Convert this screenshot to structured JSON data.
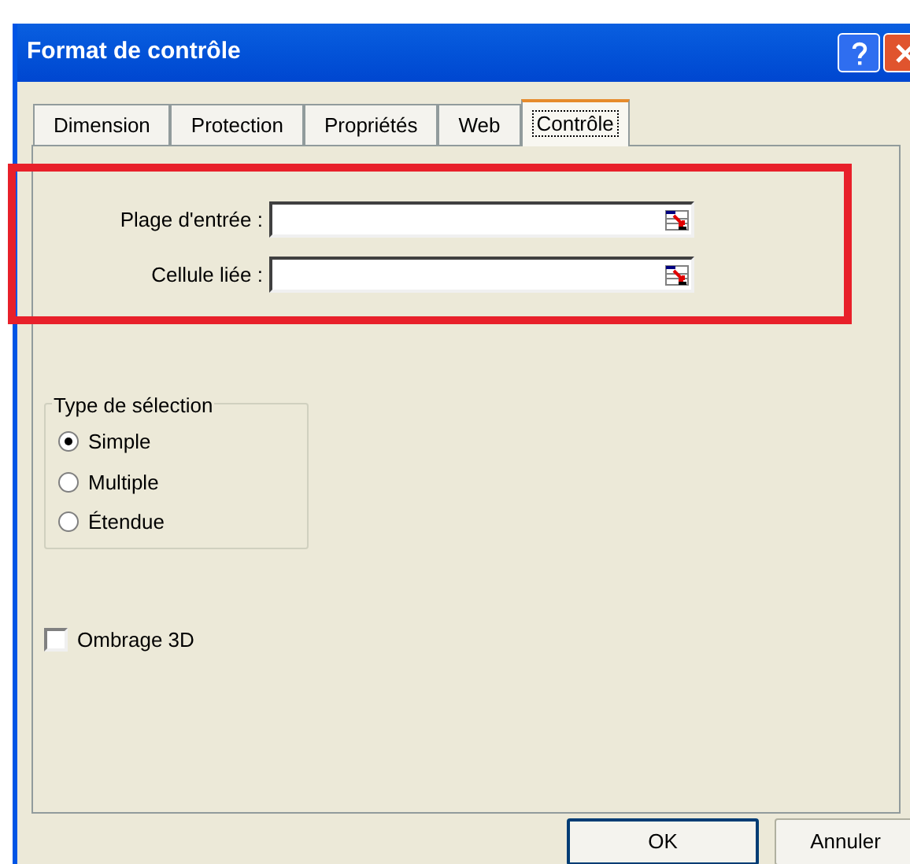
{
  "window": {
    "title": "Format de contrôle"
  },
  "tabs": [
    {
      "label": "Dimension",
      "selected": false
    },
    {
      "label": "Protection",
      "selected": false
    },
    {
      "label": "Propriétés",
      "selected": false
    },
    {
      "label": "Web",
      "selected": false
    },
    {
      "label": "Contrôle",
      "selected": true
    }
  ],
  "fields": [
    {
      "label": "Plage d'entrée :"
    },
    {
      "label": "Cellule liée :"
    }
  ],
  "selection_type": {
    "title": "Type de sélection",
    "options": [
      {
        "label": "Simple",
        "selected": true
      },
      {
        "label": "Multiple",
        "selected": false
      },
      {
        "label": "Étendue",
        "selected": false
      }
    ]
  },
  "shading": {
    "label": "Ombrage 3D",
    "checked": false
  },
  "buttons": [
    "OK",
    "Annuler"
  ]
}
